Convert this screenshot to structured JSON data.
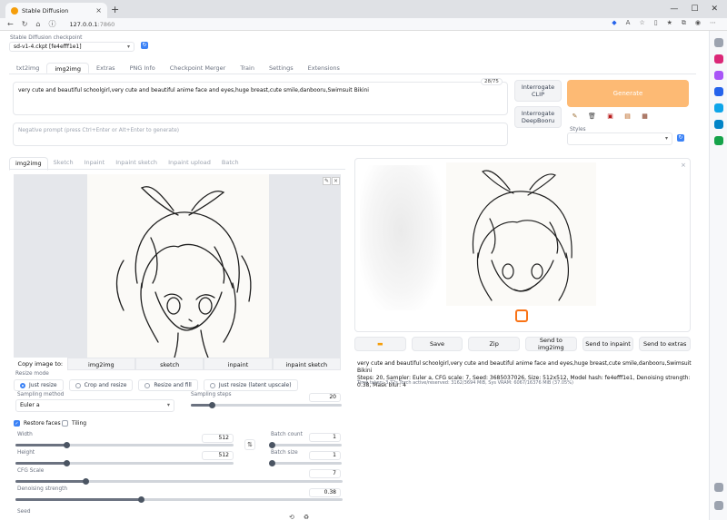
{
  "browser": {
    "tab_title": "Stable Diffusion",
    "url_host": "127.0.0.1",
    "url_port": ":7860"
  },
  "checkpoint": {
    "label": "Stable Diffusion checkpoint",
    "value": "sd-v1-4.ckpt [fe4efff1e1]"
  },
  "main_tabs": [
    "txt2img",
    "img2img",
    "Extras",
    "PNG Info",
    "Checkpoint Merger",
    "Train",
    "Settings",
    "Extensions"
  ],
  "prompt": {
    "text": "very cute and beautiful schoolgirl,very cute and beautiful anime face and eyes,huge breast,cute smile,danbooru,Swimsuit Bikini",
    "counter": "28/75",
    "negative_placeholder": "Negative prompt (press Ctrl+Enter or Alt+Enter to generate)"
  },
  "buttons": {
    "interrogate_clip": "Interrogate CLIP",
    "interrogate_deepbooru": "Interrogate DeepBooru",
    "generate": "Generate"
  },
  "styles_label": "Styles",
  "sub_tabs": [
    "img2img",
    "Sketch",
    "Inpaint",
    "Inpaint sketch",
    "Inpaint upload",
    "Batch"
  ],
  "copy_row": {
    "label": "Copy image to:",
    "targets": [
      "img2img",
      "sketch",
      "inpaint",
      "inpaint sketch"
    ]
  },
  "resize": {
    "label": "Resize mode",
    "options": [
      "Just resize",
      "Crop and resize",
      "Resize and fill",
      "Just resize (latent upscale)"
    ]
  },
  "sampling": {
    "method_label": "Sampling method",
    "method": "Euler a",
    "steps_label": "Sampling steps",
    "steps": 20
  },
  "restore_faces": "Restore faces",
  "tiling": "Tiling",
  "width": {
    "label": "Width",
    "value": 512
  },
  "height": {
    "label": "Height",
    "value": 512
  },
  "batch_count": {
    "label": "Batch count",
    "value": 1
  },
  "batch_size": {
    "label": "Batch size",
    "value": 1
  },
  "cfg": {
    "label": "CFG Scale",
    "value": 7
  },
  "denoise": {
    "label": "Denoising strength",
    "value": 0.38
  },
  "seed_label": "Seed",
  "output_buttons": [
    "Save",
    "Zip",
    "Send to img2img",
    "Send to inpaint",
    "Send to extras"
  ],
  "info": {
    "prompt": "very cute and beautiful schoolgirl,very cute and beautiful anime face and eyes,huge breast,cute smile,danbooru,Swimsuit Bikini",
    "params": "Steps: 20, Sampler: Euler a, CFG scale: 7, Seed: 3685037026, Size: 512x512, Model hash: fe4efff1e1, Denoising strength: 0.38, Mask blur: 4",
    "time": "Time taken: 3.72s   Torch active/reserved: 3162/3694 MiB, Sys VRAM: 6067/16376 MiB (37.05%)"
  }
}
